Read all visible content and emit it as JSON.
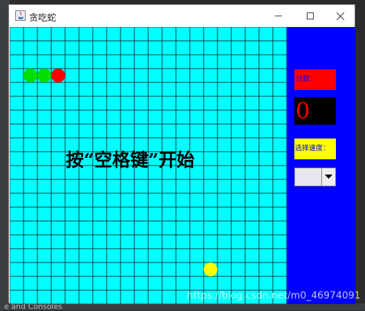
{
  "window": {
    "title": "贪吃蛇"
  },
  "game": {
    "start_message": "按“空格键”开始",
    "board_color": "#00ffff",
    "grid_color": "#0b3a3a",
    "snake_head_color": "#ff0000",
    "snake_body_color": "#00e000",
    "food_color": "#ffff00",
    "snake": [
      {
        "part": "body",
        "col": 1,
        "row": 3
      },
      {
        "part": "body",
        "col": 2,
        "row": 3
      },
      {
        "part": "head",
        "col": 3,
        "row": 3
      }
    ],
    "food": {
      "col": 14,
      "row": 17
    },
    "grid": {
      "cols": 20,
      "rows": 20
    }
  },
  "panel": {
    "background": "#0000ff",
    "score_label": "分数：",
    "score_value": "0",
    "speed_label": "选择速度：",
    "speed_selected": ""
  },
  "watermark": "https://blog.csdn.net/m0_46974091",
  "ide": {
    "bottom_tab": "e and Consoles"
  }
}
